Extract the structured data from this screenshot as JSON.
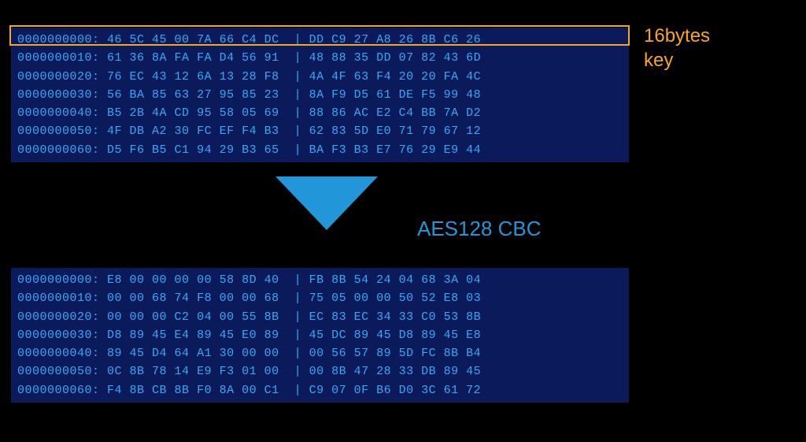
{
  "keyLabelLine1": "16bytes",
  "keyLabelLine2": "key",
  "algorithm": "AES128 CBC",
  "topHex": {
    "rows": [
      {
        "offset": "0000000000:",
        "left": "46 5C 45 00 7A 66 C4 DC",
        "right": "DD C9 27 A8 26 8B C6 26"
      },
      {
        "offset": "0000000010:",
        "left": "61 36 8A FA FA D4 56 91",
        "right": "48 88 35 DD 07 82 43 6D"
      },
      {
        "offset": "0000000020:",
        "left": "76 EC 43 12 6A 13 28 F8",
        "right": "4A 4F 63 F4 20 20 FA 4C"
      },
      {
        "offset": "0000000030:",
        "left": "56 BA 85 63 27 95 85 23",
        "right": "8A F9 D5 61 DE F5 99 48"
      },
      {
        "offset": "0000000040:",
        "left": "B5 2B 4A CD 95 58 05 69",
        "right": "88 86 AC E2 C4 BB 7A D2"
      },
      {
        "offset": "0000000050:",
        "left": "4F DB A2 30 FC EF F4 B3",
        "right": "62 83 5D E0 71 79 67 12"
      },
      {
        "offset": "0000000060:",
        "left": "D5 F6 B5 C1 94 29 B3 65",
        "right": "BA F3 B3 E7 76 29 E9 44"
      }
    ]
  },
  "bottomHex": {
    "rows": [
      {
        "offset": "0000000000:",
        "left": "E8 00 00 00 00 58 8D 40",
        "right": "FB 8B 54 24 04 68 3A 04"
      },
      {
        "offset": "0000000010:",
        "left": "00 00 68 74 F8 00 00 68",
        "right": "75 05 00 00 50 52 E8 03"
      },
      {
        "offset": "0000000020:",
        "left": "00 00 00 C2 04 00 55 8B",
        "right": "EC 83 EC 34 33 C0 53 8B"
      },
      {
        "offset": "0000000030:",
        "left": "D8 89 45 E4 89 45 E0 89",
        "right": "45 DC 89 45 D8 89 45 E8"
      },
      {
        "offset": "0000000040:",
        "left": "89 45 D4 64 A1 30 00 00",
        "right": "00 56 57 89 5D FC 8B B4"
      },
      {
        "offset": "0000000050:",
        "left": "0C 8B 78 14 E9 F3 01 00",
        "right": "00 8B 47 28 33 DB 89 45"
      },
      {
        "offset": "0000000060:",
        "left": "F4 8B CB 8B F0 8A 00 C1",
        "right": "C9 07 0F B6 D0 3C 61 72"
      }
    ]
  }
}
